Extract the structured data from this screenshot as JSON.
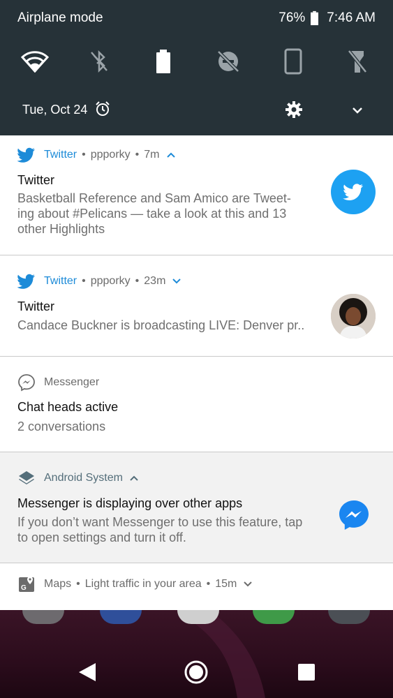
{
  "status_bar": {
    "mode_label": "Airplane mode",
    "battery": "76%",
    "time": "7:46 AM"
  },
  "quick_settings": {
    "tiles": [
      "wifi-icon",
      "bluetooth-off-icon",
      "battery-saver-icon",
      "do-not-disturb-off-icon",
      "auto-rotate-icon",
      "flashlight-off-icon"
    ],
    "date": "Tue, Oct 24"
  },
  "notifications": [
    {
      "app": "Twitter",
      "account": "ppporky",
      "age": "7m",
      "title": "Twitter",
      "body": "Basketball Reference and Sam Amico are Tweet-ing about #Pelicans — take a look at this and 13 other Highlights"
    },
    {
      "app": "Twitter",
      "account": "ppporky",
      "age": "23m",
      "title": "Twitter",
      "body": "Candace Buckner is broadcasting LIVE: Denver pr.."
    },
    {
      "app": "Messenger",
      "title": "Chat heads active",
      "body": "2 conversations"
    },
    {
      "app": "Android System",
      "title": "Messenger is displaying over other apps",
      "body": "If you don’t want Messenger to use this feature, tap to open settings and turn it off."
    },
    {
      "app": "Maps",
      "summary": "Light traffic in your area",
      "age": "15m"
    }
  ],
  "colors": {
    "shade": "#263238",
    "twitter_blue": "#1d8bd8",
    "messenger_blue": "#1a86f0"
  }
}
